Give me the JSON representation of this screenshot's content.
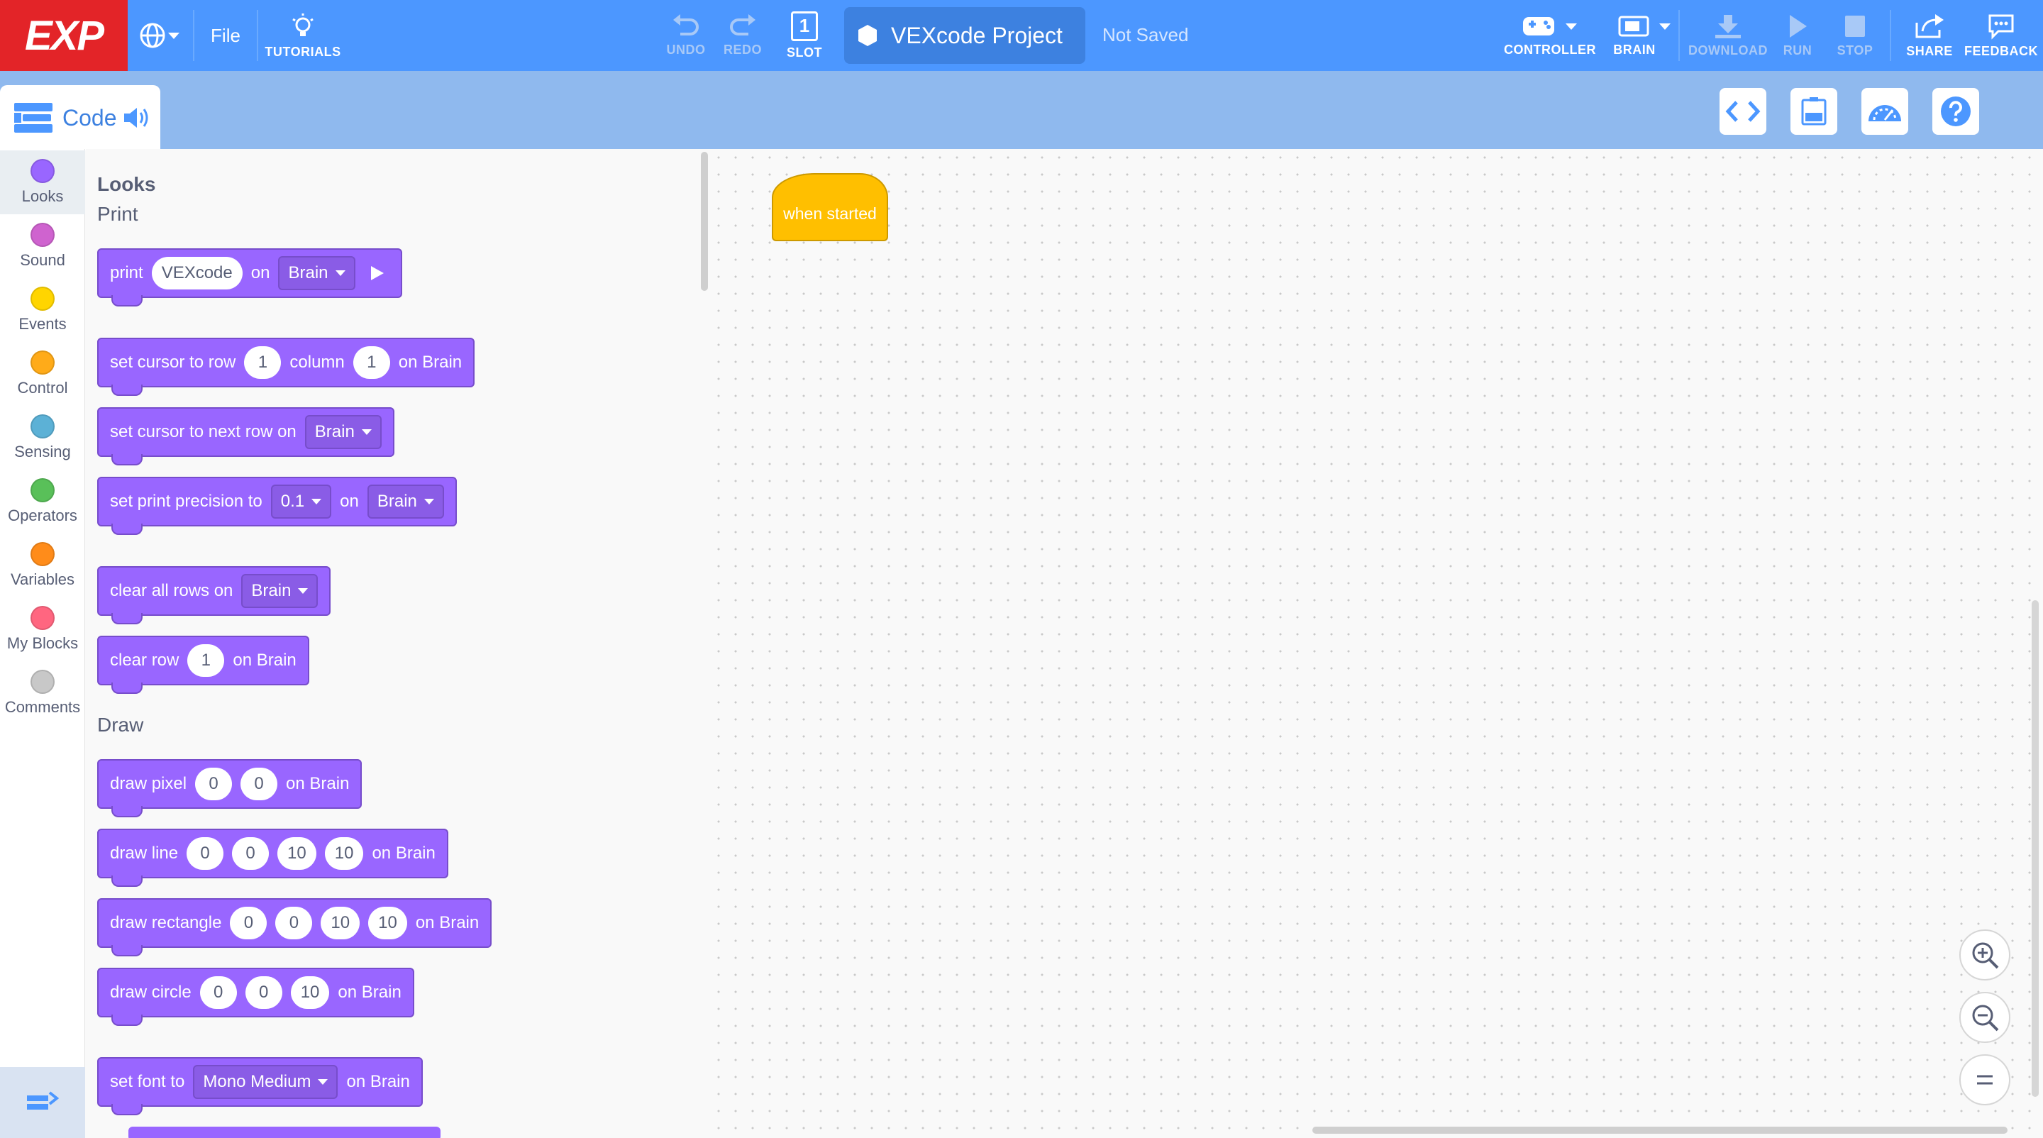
{
  "topbar": {
    "logo": "EXP",
    "file_label": "File",
    "tutorials_label": "TUTORIALS",
    "undo_label": "UNDO",
    "redo_label": "REDO",
    "slot_label": "SLOT",
    "slot_number": "1",
    "project_name": "VEXcode Project",
    "save_status": "Not Saved",
    "controller_label": "CONTROLLER",
    "brain_label": "BRAIN",
    "download_label": "DOWNLOAD",
    "run_label": "RUN",
    "stop_label": "STOP",
    "share_label": "SHARE",
    "feedback_label": "FEEDBACK"
  },
  "tabs": {
    "code_label": "Code"
  },
  "categories": [
    {
      "label": "Looks",
      "color": "#9966ff"
    },
    {
      "label": "Sound",
      "color": "#cf63cf"
    },
    {
      "label": "Events",
      "color": "#ffd500"
    },
    {
      "label": "Control",
      "color": "#ffab19"
    },
    {
      "label": "Sensing",
      "color": "#5cb1d6"
    },
    {
      "label": "Operators",
      "color": "#59c059"
    },
    {
      "label": "Variables",
      "color": "#ff8c1a"
    },
    {
      "label": "My Blocks",
      "color": "#ff6680"
    },
    {
      "label": "Comments",
      "color": "#c8c8c8"
    }
  ],
  "flyout": {
    "category_title": "Looks",
    "section_print": "Print",
    "section_draw": "Draw",
    "b_print": {
      "w1": "print",
      "v1": "VEXcode",
      "w2": "on",
      "d1": "Brain"
    },
    "b_cursor": {
      "w1": "set cursor to row",
      "v1": "1",
      "w2": "column",
      "v2": "1",
      "w3": "on Brain"
    },
    "b_nextrow": {
      "w1": "set cursor to next row on",
      "d1": "Brain"
    },
    "b_precision": {
      "w1": "set print precision to",
      "d1": "0.1",
      "w2": "on",
      "d2": "Brain"
    },
    "b_clearall": {
      "w1": "clear all rows on",
      "d1": "Brain"
    },
    "b_clearrow": {
      "w1": "clear row",
      "v1": "1",
      "w2": "on Brain"
    },
    "b_pixel": {
      "w1": "draw pixel",
      "v1": "0",
      "v2": "0",
      "w2": "on Brain"
    },
    "b_line": {
      "w1": "draw line",
      "v1": "0",
      "v2": "0",
      "v3": "10",
      "v4": "10",
      "w2": "on Brain"
    },
    "b_rect": {
      "w1": "draw rectangle",
      "v1": "0",
      "v2": "0",
      "v3": "10",
      "v4": "10",
      "w2": "on Brain"
    },
    "b_circle": {
      "w1": "draw circle",
      "v1": "0",
      "v2": "0",
      "v3": "10",
      "w2": "on Brain"
    },
    "b_font": {
      "w1": "set font to",
      "d1": "Mono Medium",
      "w2": "on Brain"
    }
  },
  "workspace": {
    "hat_block": "when started"
  },
  "colors": {
    "topbar": "#4c97ff",
    "logo": "#e32428",
    "looks_block": "#9966ff",
    "events_block": "#ffbf00"
  }
}
